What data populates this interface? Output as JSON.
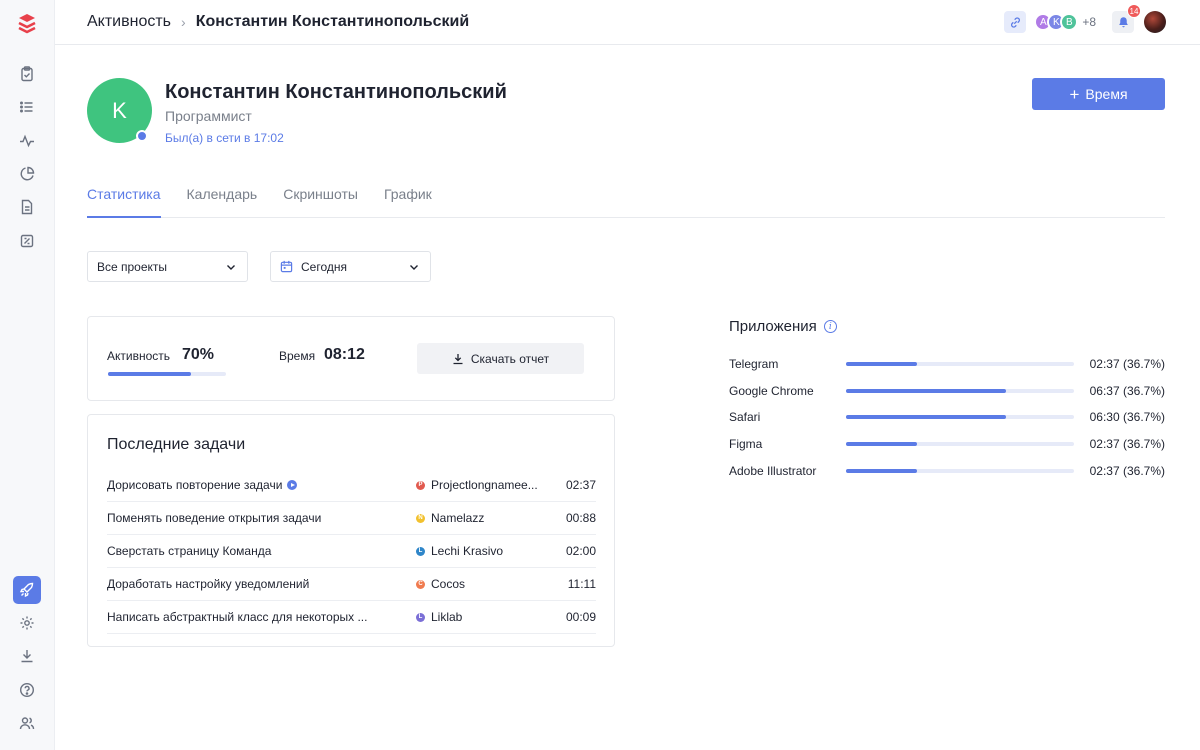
{
  "header": {
    "breadcrumb_section": "Активность",
    "breadcrumb_separator": "›",
    "breadcrumb_current": "Константин Константинопольский",
    "team_avatars": [
      {
        "letter": "A",
        "color": "#b07be6"
      },
      {
        "letter": "K",
        "color": "#7b87e6"
      },
      {
        "letter": "B",
        "color": "#4fc39a"
      }
    ],
    "team_more": "+8",
    "notifications_count": "14"
  },
  "profile": {
    "initial": "K",
    "name": "Константин Константинопольский",
    "role": "Программист",
    "status": "Был(а) в сети в 17:02",
    "add_time_label": "Время"
  },
  "tabs": [
    {
      "label": "Статистика",
      "active": true
    },
    {
      "label": "Календарь",
      "active": false
    },
    {
      "label": "Скриншоты",
      "active": false
    },
    {
      "label": "График",
      "active": false
    }
  ],
  "filters": {
    "project": "Все проекты",
    "period": "Сегодня"
  },
  "stats": {
    "activity_label": "Активность",
    "activity_value": "70%",
    "activity_fraction": 0.7,
    "time_label": "Время",
    "time_value": "08:12",
    "download_label": "Скачать отчет"
  },
  "tasks": {
    "title": "Последние задачи",
    "rows": [
      {
        "name": "Дорисовать повторение задачи",
        "playing": true,
        "project_letter": "P",
        "project_color": "#e15a4f",
        "project": "Projectlongnamee...",
        "time": "02:37"
      },
      {
        "name": "Поменять поведение открытия задачи",
        "playing": false,
        "project_letter": "N",
        "project_color": "#f2c12e",
        "project": "Namelazz",
        "time": "00:88"
      },
      {
        "name": "Сверстать страницу Команда",
        "playing": false,
        "project_letter": "L",
        "project_color": "#2f86c9",
        "project": "Lechi Krasivo",
        "time": "02:00"
      },
      {
        "name": "Доработать настройку уведомлений",
        "playing": false,
        "project_letter": "C",
        "project_color": "#f07b4f",
        "project": "Cocos",
        "time": "11:11"
      },
      {
        "name": "Написать абстрактный класс для некоторых ...",
        "playing": false,
        "project_letter": "L",
        "project_color": "#7b6fd6",
        "project": "Liklab",
        "time": "00:09"
      }
    ]
  },
  "apps": {
    "title": "Приложения",
    "rows": [
      {
        "name": "Telegram",
        "fraction": 0.31,
        "time": "02:37 (36.7%)"
      },
      {
        "name": "Google Chrome",
        "fraction": 0.7,
        "time": "06:37 (36.7%)"
      },
      {
        "name": "Safari",
        "fraction": 0.7,
        "time": "06:30 (36.7%)"
      },
      {
        "name": "Figma",
        "fraction": 0.31,
        "time": "02:37 (36.7%)"
      },
      {
        "name": "Adobe Illustrator",
        "fraction": 0.31,
        "time": "02:37 (36.7%)"
      }
    ]
  },
  "sidebar": {
    "icons": [
      "clipboard-check-icon",
      "list-icon",
      "activity-icon",
      "pie-chart-icon",
      "document-icon",
      "report-icon",
      "rocket-icon",
      "settings-icon",
      "download-icon",
      "help-icon",
      "users-icon"
    ]
  },
  "colors": {
    "accent": "#5b7be6",
    "avatar_green": "#3fc47f",
    "badge_red": "#ef5a5a",
    "logo_red": "#e8414b"
  }
}
